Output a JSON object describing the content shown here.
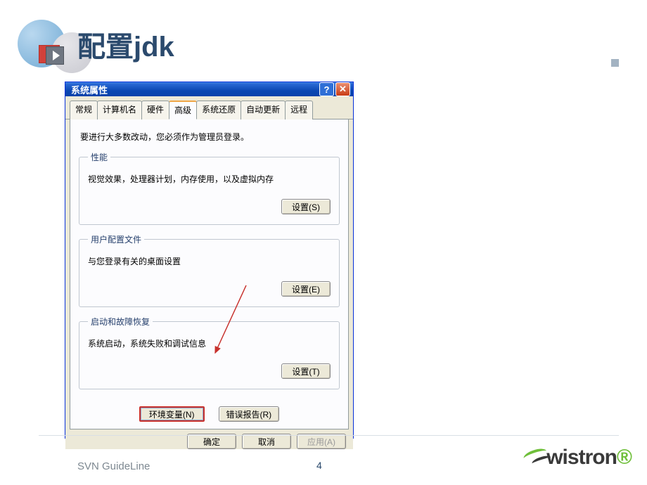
{
  "slide": {
    "title": "配置jdk",
    "footer": "SVN GuideLine",
    "page_number": "4",
    "brand": "wistron"
  },
  "dialog": {
    "title": "系统属性",
    "tabs": {
      "general": "常规",
      "computer_name": "计算机名",
      "hardware": "硬件",
      "advanced": "高级",
      "system_restore": "系统还原",
      "auto_update": "自动更新",
      "remote": "远程"
    },
    "notice": "要进行大多数改动，您必须作为管理员登录。",
    "performance": {
      "legend": "性能",
      "text": "视觉效果，处理器计划，内存使用，以及虚拟内存",
      "button": "设置(S)"
    },
    "user_profile": {
      "legend": "用户配置文件",
      "text": "与您登录有关的桌面设置",
      "button": "设置(E)"
    },
    "startup": {
      "legend": "启动和故障恢复",
      "text": "系统启动，系统失败和调试信息",
      "button": "设置(T)"
    },
    "env_vars_button": "环境变量(N)",
    "error_report_button": "错误报告(R)",
    "footer": {
      "ok": "确定",
      "cancel": "取消",
      "apply": "应用(A)"
    }
  }
}
